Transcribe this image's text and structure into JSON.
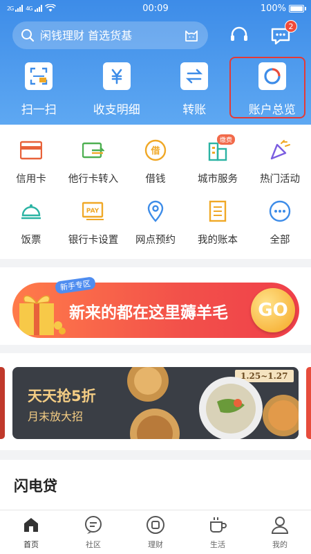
{
  "status_bar": {
    "signal_left": "2G",
    "signal_right": "4G",
    "time": "00:09",
    "battery": "100%",
    "battery_level": 1.0
  },
  "header": {
    "search": {
      "placeholder": "闲钱理财 首选货基"
    },
    "message_badge": "2",
    "quick_actions": [
      {
        "label": "扫一扫",
        "icon": "scan-icon"
      },
      {
        "label": "收支明细",
        "icon": "yuan-icon"
      },
      {
        "label": "转账",
        "icon": "transfer-icon"
      },
      {
        "label": "账户总览",
        "icon": "account-overview-icon"
      }
    ]
  },
  "grid": {
    "items": [
      {
        "label": "信用卡",
        "icon": "credit-card-icon",
        "color": "#e8623a"
      },
      {
        "label": "他行卡转入",
        "icon": "card-transfer-icon",
        "color": "#4caf50"
      },
      {
        "label": "借钱",
        "icon": "borrow-icon",
        "color": "#f0a826",
        "glyph": "借"
      },
      {
        "label": "城市服务",
        "icon": "city-icon",
        "color": "#2bb3a3",
        "badge": "缴费"
      },
      {
        "label": "热门活动",
        "icon": "party-icon",
        "color": "#7b5de0"
      },
      {
        "label": "饭票",
        "icon": "dining-icon",
        "color": "#2bb3a3"
      },
      {
        "label": "银行卡设置",
        "icon": "pay-card-icon",
        "color": "#f0a826",
        "glyph": "PAY"
      },
      {
        "label": "网点预约",
        "icon": "location-icon",
        "color": "#3d8ce8"
      },
      {
        "label": "我的账本",
        "icon": "ledger-icon",
        "color": "#f0a826"
      },
      {
        "label": "全部",
        "icon": "more-icon",
        "color": "#3d8ce8"
      }
    ]
  },
  "promo": {
    "tag": "新手专区",
    "text": "新来的都在这里薅羊毛",
    "go": "GO"
  },
  "food_banner": {
    "title": "天天抢5折",
    "subtitle": "月末放大招",
    "date": "1.25~1.27"
  },
  "loan": {
    "title": "闪电贷"
  },
  "tabbar": {
    "tabs": [
      {
        "label": "首页",
        "icon": "home-icon"
      },
      {
        "label": "社区",
        "icon": "community-icon"
      },
      {
        "label": "理财",
        "icon": "finance-icon"
      },
      {
        "label": "生活",
        "icon": "coffee-icon"
      },
      {
        "label": "我的",
        "icon": "profile-icon"
      }
    ]
  }
}
